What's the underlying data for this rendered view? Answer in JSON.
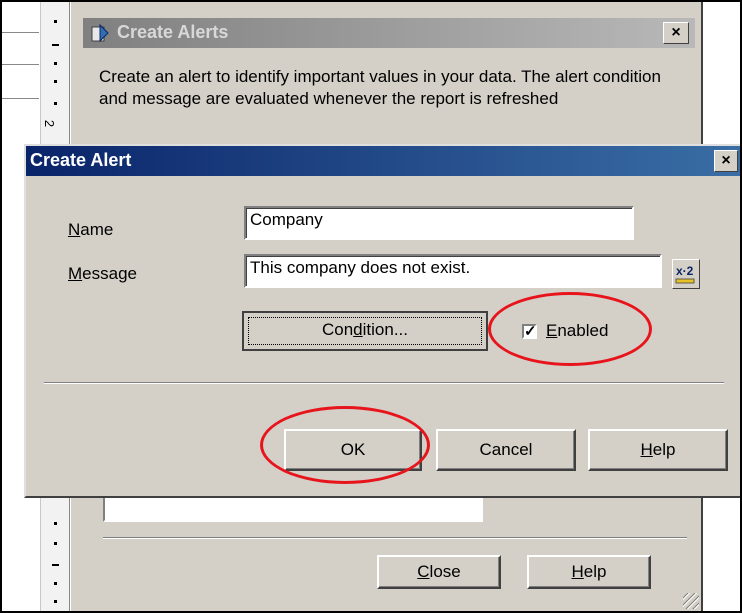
{
  "ruler": {
    "number": "2"
  },
  "background_dialog": {
    "title": "Create Alerts",
    "close_glyph": "×",
    "description": "Create an alert to identify important values in your data. The alert condition and message are evaluated whenever the report is refreshed",
    "close_button": {
      "pre": "",
      "accel": "C",
      "post": "lose"
    },
    "help_button": {
      "pre": "",
      "accel": "H",
      "post": "elp"
    }
  },
  "dialog": {
    "title": "Create Alert",
    "close_glyph": "×",
    "name_label": {
      "pre": "",
      "accel": "N",
      "post": "ame"
    },
    "name_value": "Company",
    "message_label": {
      "pre": "",
      "accel": "M",
      "post": "essage"
    },
    "message_value": "This company does not exist.",
    "formula_icon_text": "x·2",
    "condition_button": {
      "pre": "Con",
      "accel": "d",
      "post": "ition..."
    },
    "enabled": {
      "checked": true,
      "mark": "✓",
      "pre": "",
      "accel": "E",
      "post": "nabled"
    },
    "ok_button": "OK",
    "cancel_button": "Cancel",
    "help_button": {
      "pre": "",
      "accel": "H",
      "post": "elp"
    }
  },
  "annotations": {
    "color": "#e8141c"
  },
  "colors": {
    "dialog_face": "#d4d0c8",
    "active_title": "#0a246a",
    "inactive_title": "#808080"
  }
}
